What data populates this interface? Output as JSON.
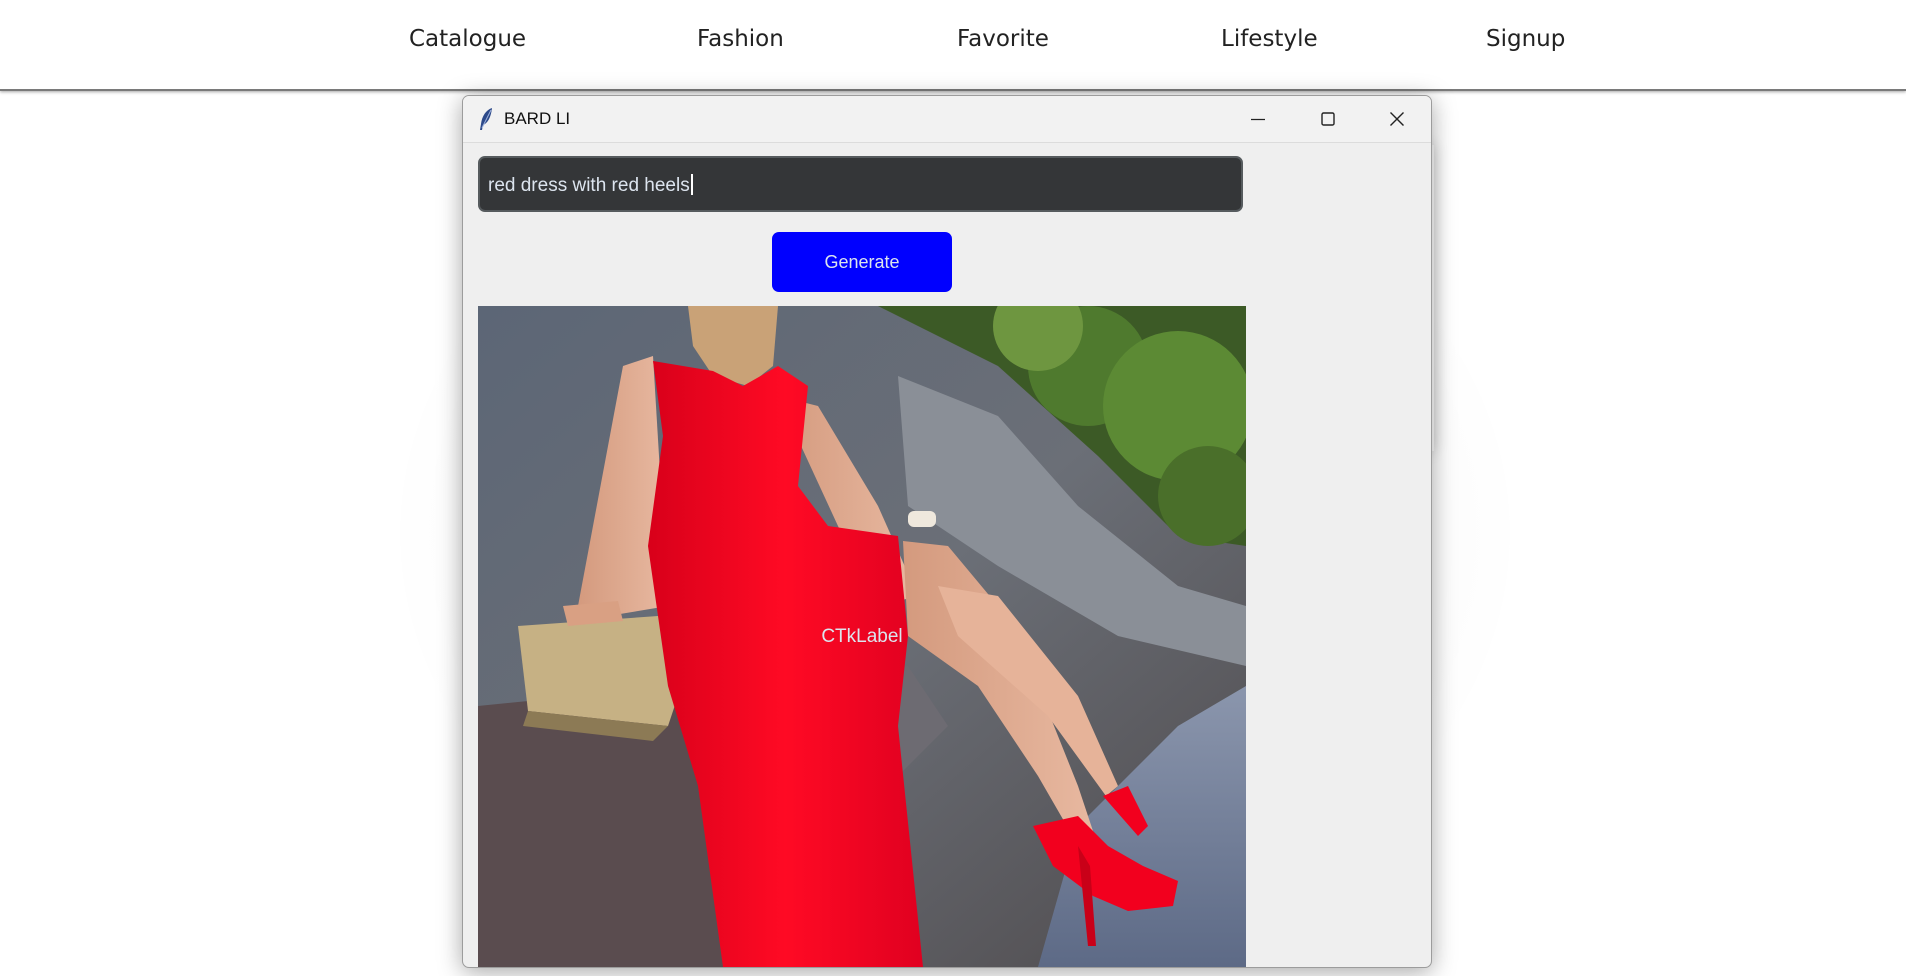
{
  "nav": {
    "items": [
      {
        "label": "Catalogue"
      },
      {
        "label": "Fashion"
      },
      {
        "label": "Favorite"
      },
      {
        "label": "Lifestyle"
      },
      {
        "label": "Signup"
      }
    ]
  },
  "window": {
    "title": "BARD LI",
    "icon": "feather-icon",
    "controls": [
      "minimize-icon",
      "maximize-icon",
      "close-icon"
    ]
  },
  "app": {
    "prompt_value": "red dress with red heels",
    "generate_label": "Generate",
    "image_label_text": "CTkLabel",
    "image_description": "woman in red dress with red heels sitting on rocks",
    "colors": {
      "button": "#0000ff",
      "entry_bg": "#343638",
      "window_bg": "#efefef",
      "dress": "#f2001e"
    }
  }
}
